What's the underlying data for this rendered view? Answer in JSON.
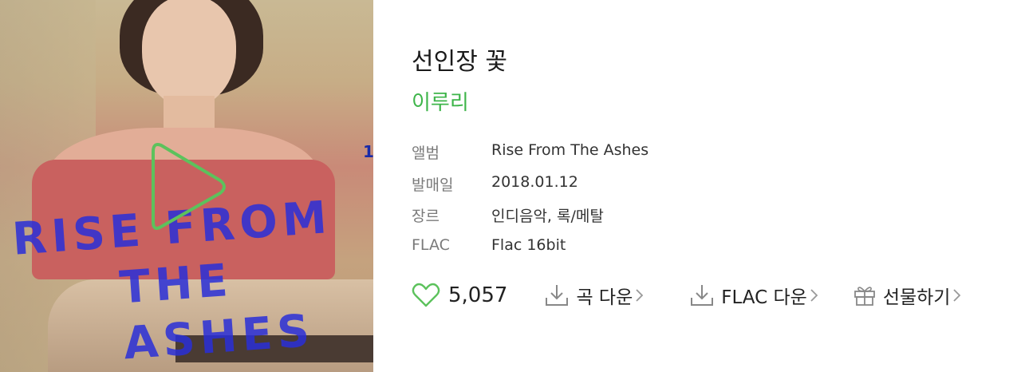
{
  "song": {
    "title": "선인장 꽃",
    "artist": "이루리"
  },
  "cover": {
    "text_line1": "RISE FROM",
    "text_line2": "THE ASHES",
    "edge_number": "1"
  },
  "meta": [
    {
      "label": "앨범",
      "value": "Rise From The Ashes"
    },
    {
      "label": "발매일",
      "value": "2018.01.12"
    },
    {
      "label": "장르",
      "value": "인디음악, 록/메탈"
    },
    {
      "label": "FLAC",
      "value": "Flac 16bit"
    }
  ],
  "actions": {
    "like_count": "5,057",
    "song_download": "곡 다운",
    "flac_download": "FLAC 다운",
    "gift": "선물하기"
  },
  "colors": {
    "accent_green": "#3eb54a",
    "play_outline": "#5cc25c"
  },
  "icons": {
    "play": "play-icon",
    "like": "heart-icon",
    "download": "download-icon",
    "gift": "gift-icon",
    "chevron": "chevron-right-icon"
  }
}
